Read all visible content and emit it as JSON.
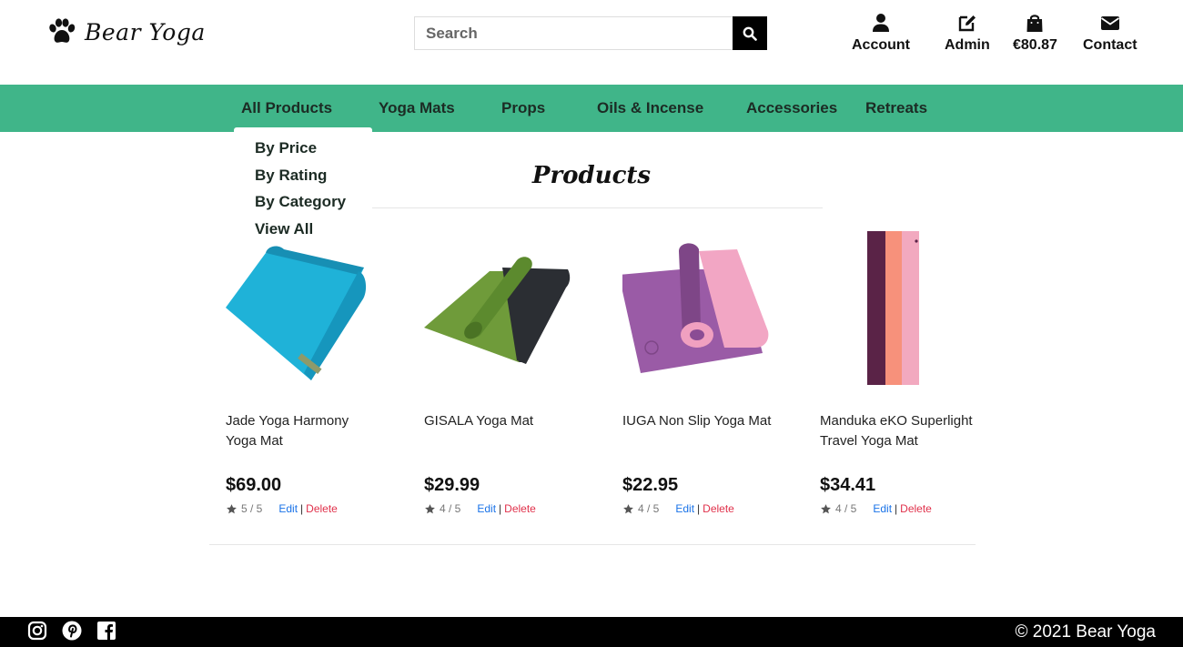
{
  "header": {
    "logo_text": "Bear Yoga",
    "search_placeholder": "Search",
    "nav_icons": [
      {
        "label": "Account",
        "icon": "user-icon"
      },
      {
        "label": "Admin",
        "icon": "edit-icon"
      },
      {
        "label": "€80.87",
        "icon": "shopping-bag-icon"
      },
      {
        "label": "Contact",
        "icon": "envelope-icon"
      }
    ]
  },
  "main_nav": {
    "items": [
      "All Products",
      "Yoga Mats",
      "Props",
      "Oils & Incense",
      "Accessories",
      "Retreats"
    ],
    "background_color": "#40b589"
  },
  "dropdown": {
    "items": [
      "By Price",
      "By Rating",
      "By Category",
      "View All"
    ]
  },
  "content": {
    "title": "Products",
    "products": [
      {
        "name": "Jade Yoga Harmony Yoga Mat",
        "price": "$69.00",
        "rating": "5 / 5",
        "edit": "Edit",
        "sep": "|",
        "delete": "Delete",
        "color": "#1fb2d8"
      },
      {
        "name": "GISALA Yoga Mat",
        "price": "$29.99",
        "rating": "4 / 5",
        "edit": "Edit",
        "sep": "|",
        "delete": "Delete",
        "color": "#6f9b3a"
      },
      {
        "name": "IUGA Non Slip Yoga Mat",
        "price": "$22.95",
        "rating": "4 / 5",
        "edit": "Edit",
        "sep": "|",
        "delete": "Delete",
        "color": "#9a5ba6"
      },
      {
        "name": "Manduka eKO Superlight Travel Yoga Mat",
        "price": "$34.41",
        "rating": "4 / 5",
        "edit": "Edit",
        "sep": "|",
        "delete": "Delete",
        "color": "#5a2347"
      }
    ]
  },
  "footer": {
    "social": [
      "instagram-icon",
      "pinterest-icon",
      "facebook-icon"
    ],
    "copyright": "© 2021 Bear Yoga"
  }
}
